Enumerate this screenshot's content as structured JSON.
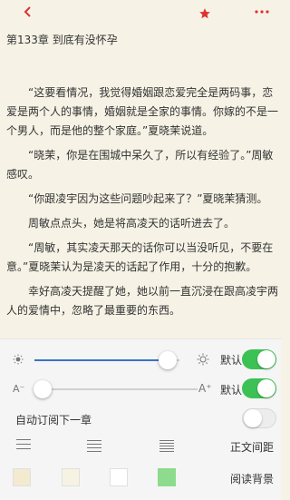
{
  "header": {
    "back_icon": "chevron-left-icon",
    "bookmark_icon": "star-icon",
    "more_icon": "more-icon",
    "accent_color": "#d33"
  },
  "chapter_title": "第133章  到底有没怀孕",
  "paragraphs": [
    "“这要看情况，我觉得婚姻跟恋爱完全是两码事，恋爱是两个人的事情，婚姻就是全家的事情。你嫁的不是一个男人，而是他的整个家庭。”夏晓茉说道。",
    "“晓茉，你是在围城中呆久了，所以有经验了。”周敏感叹。",
    "“你跟凌宇因为这些问题吵起来了？”夏晓茉猜测。",
    "周敏点点头，她是将高凌天的话听进去了。",
    "“周敏，其实凌天那天的话你可以当没听见，不要在意。”夏晓茉认为是凌天的话起了作用，十分的抱歉。",
    "幸好高凌天提醒了她，她以前一直沉浸在跟高凌宇两人的爱情中，忽略了最重要的东西。"
  ],
  "settings": {
    "brightness": {
      "low_icon": "sun-small-icon",
      "high_icon": "sun-large-icon",
      "level": 0.92,
      "default_label": "默认",
      "default_on": true
    },
    "font_size": {
      "small_label": "A⁻",
      "large_label": "A⁺",
      "level": 0.05,
      "default_label": "默认",
      "default_on": true
    },
    "auto_subscribe": {
      "label": "自动订阅下一章",
      "on": false
    },
    "line_spacing": {
      "label": "正文间距",
      "options": [
        "spacing-loose-icon",
        "spacing-medium-icon",
        "spacing-tight-icon"
      ]
    },
    "background": {
      "label": "阅读背景",
      "swatches": [
        "#f3ead0",
        "#f6f3e2",
        "#ffffff",
        "#8ddb8c"
      ]
    }
  },
  "colors": {
    "toggle_on": "#3cc155",
    "slider_fill": "#3a73c5"
  }
}
